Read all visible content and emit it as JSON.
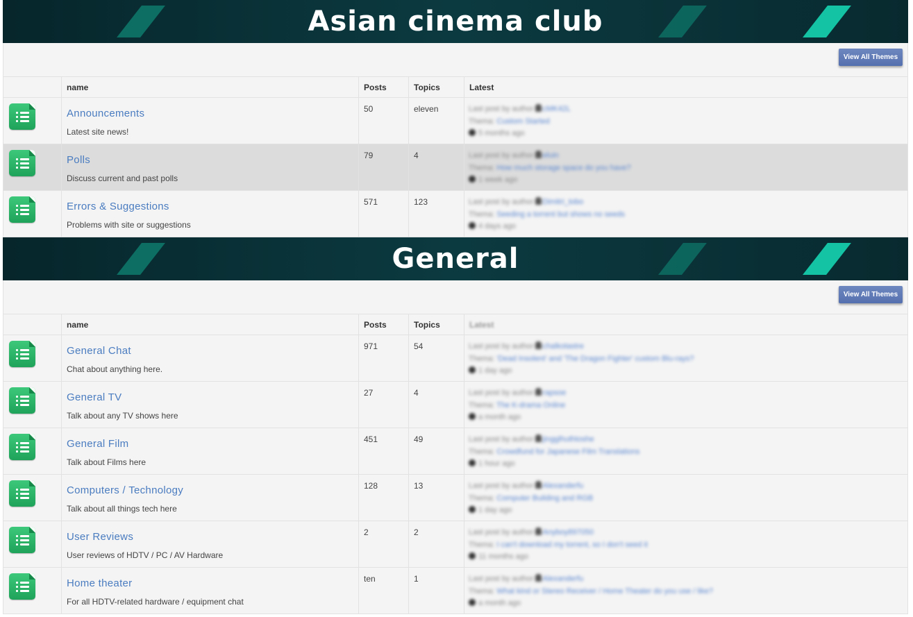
{
  "sections": [
    {
      "title": "Asian cinema club",
      "button_label": "View All Themes",
      "columns": {
        "name": "name",
        "posts": "Posts",
        "topics": "Topics",
        "latest": "Latest"
      },
      "forums": [
        {
          "name": "Announcements",
          "desc": "Latest site news!",
          "posts": "50",
          "topics": "eleven",
          "latest": {
            "prefix": "Last post by author",
            "user": "cMK42L",
            "thread_label": "Thema",
            "thread": "Custom Started",
            "time": "5 months ago"
          }
        },
        {
          "name": "Polls",
          "desc": "Discuss current and past polls",
          "posts": "79",
          "topics": "4",
          "latest": {
            "prefix": "Last post by author",
            "user": "eluin",
            "thread_label": "Thema",
            "thread": "How much storage space do you have?",
            "time": "1 week ago"
          }
        },
        {
          "name": "Errors & Suggestions",
          "desc": "Problems with site or suggestions",
          "posts": "571",
          "topics": "123",
          "latest": {
            "prefix": "Last post by author",
            "user": "Dimitri_tobo",
            "thread_label": "Thema",
            "thread": "Seeding a torrent but shows no seeds",
            "time": "4 days ago"
          }
        }
      ]
    },
    {
      "title": "General",
      "button_label": "View All Themes",
      "columns": {
        "name": "name",
        "posts": "Posts",
        "topics": "Topics",
        "latest": "Latest"
      },
      "forums": [
        {
          "name": "General Chat",
          "desc": "Chat about anything here.",
          "posts": "971",
          "topics": "54",
          "latest": {
            "prefix": "Last post by author",
            "user": "chalkotastre",
            "thread_label": "Thema",
            "thread": "'Dead Insolent' and 'The Dragon Fighter' custom Blu-rays?",
            "time": "1 day ago"
          }
        },
        {
          "name": "General TV",
          "desc": "Talk about any TV shows here",
          "posts": "27",
          "topics": "4",
          "latest": {
            "prefix": "Last post by author",
            "user": "rapsoe",
            "thread_label": "Thema",
            "thread": "The K-drama Online",
            "time": "a month ago"
          }
        },
        {
          "name": "General Film",
          "desc": "Talk about Films here",
          "posts": "451",
          "topics": "49",
          "latest": {
            "prefix": "Last post by author",
            "user": "jingglhuthtoshe",
            "thread_label": "Thema",
            "thread": "Crowdfund for Japanese Film Translations",
            "time": "1 hour ago"
          }
        },
        {
          "name": "Computers / Technology",
          "desc": "Talk about all things tech here",
          "posts": "128",
          "topics": "13",
          "latest": {
            "prefix": "Last post by author",
            "user": "Alexanderfu",
            "thread_label": "Thema",
            "thread": "Computer Building and RGB",
            "time": "1 day ago"
          }
        },
        {
          "name": "User Reviews",
          "desc": "User reviews of HDTV / PC / AV Hardware",
          "posts": "2",
          "topics": "2",
          "latest": {
            "prefix": "Last post by author",
            "user": "Anyboy897050",
            "thread_label": "Thema",
            "thread": "I can't download my torrent, so I don't seed it",
            "time": "11 months ago"
          }
        },
        {
          "name": "Home theater",
          "desc": "For all HDTV-related hardware / equipment chat",
          "posts": "ten",
          "topics": "1",
          "latest": {
            "prefix": "Last post by author",
            "user": "Alexanderfu",
            "thread_label": "Thema",
            "thread": "What kind or Stereo Receiver / Home Theater do you use / like?",
            "time": "a month ago"
          }
        }
      ]
    }
  ],
  "highlight_row": {
    "section": 0,
    "row": 1
  },
  "colors": {
    "banner_bg": "#082a2f",
    "accent_stripe": "#13c3a3",
    "link": "#4a7cc0",
    "button": "#5f7bb8",
    "icon_green": "#2cb56a"
  },
  "icons": {
    "forum": "list-document-icon",
    "user": "person-icon",
    "time": "clock-icon"
  }
}
